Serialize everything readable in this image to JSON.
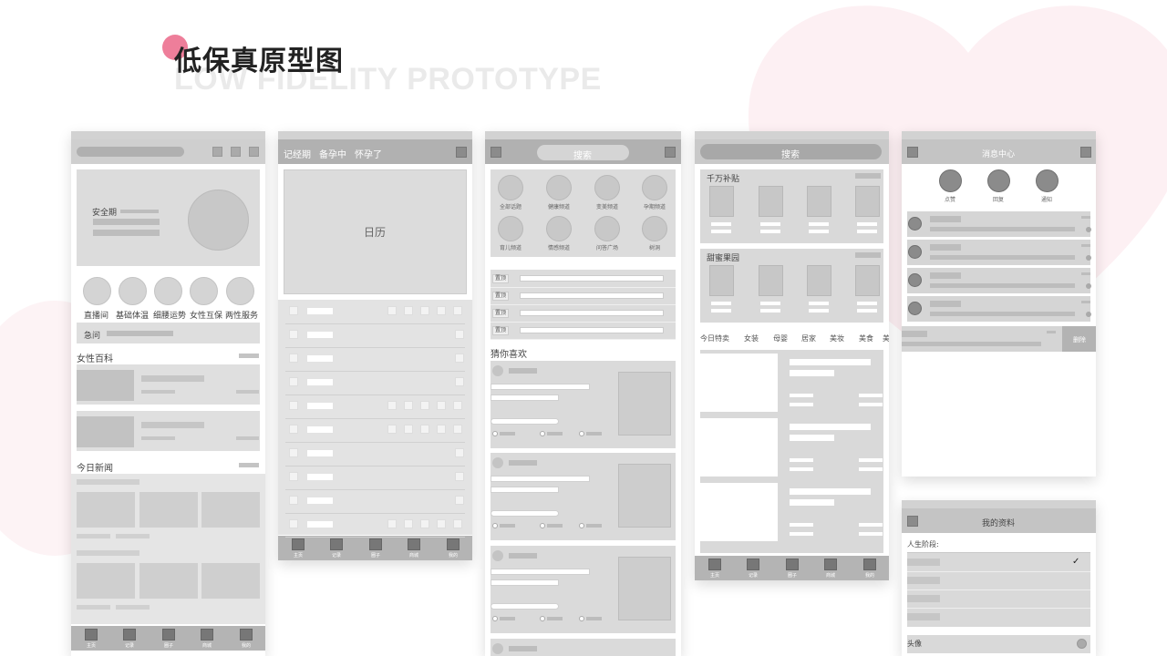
{
  "header": {
    "title_cn": "低保真原型图",
    "title_en": "LOW FIDELITY PROTOTYPE"
  },
  "colors": {
    "accent": "#ee7e9a",
    "heart": "#fdf0f3",
    "wire_dark": "#8b8b8b",
    "wire_mid": "#b1b1b1",
    "wire_light": "#e6e6e6"
  },
  "screen1": {
    "banner_label": "安全期",
    "categories": [
      "直播间",
      "基础体温",
      "细腰运势",
      "女性互保",
      "两性服务"
    ],
    "ask_label": "急问",
    "section_women": "女性百科",
    "section_news": "今日新闻",
    "tabs": [
      "主页",
      "记录",
      "圈子",
      "商城",
      "我的"
    ]
  },
  "screen2": {
    "nav": [
      "记经期",
      "备孕中",
      "怀孕了"
    ],
    "calendar_label": "日历",
    "tabs": [
      "主页",
      "记录",
      "圈子",
      "商城",
      "我的"
    ]
  },
  "screen3": {
    "search_label": "搜索",
    "channels": [
      "全部话题",
      "健康频道",
      "变美频道",
      "孕期频道",
      "育儿频道",
      "情感频道",
      "问答广场",
      "树洞"
    ],
    "pinned_tag": "置顶",
    "guess_label": "猜你喜欢"
  },
  "screen4": {
    "search_label": "搜索",
    "section_subsidy": "千万补贴",
    "section_honey": "甜蜜果园",
    "category_tabs": [
      "今日特卖",
      "女装",
      "母婴",
      "居家",
      "美妆",
      "美食",
      "美"
    ],
    "tabs": [
      "主页",
      "记录",
      "圈子",
      "商城",
      "我的"
    ]
  },
  "screen5": {
    "title": "消息中心",
    "top_actions": [
      "点赞",
      "回复",
      "通知"
    ],
    "delete_label": "删除"
  },
  "screen6": {
    "title": "我的资料",
    "life_stage_label": "人生阶段:",
    "checkmark": "✓",
    "avatar_label": "头像"
  }
}
